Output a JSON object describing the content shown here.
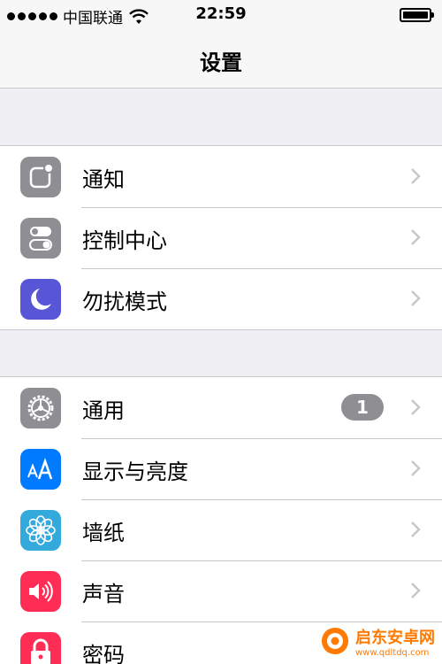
{
  "status_bar": {
    "carrier": "中国联通",
    "time": "22:59",
    "signal_icon": "signal-dots-icon",
    "wifi_icon": "wifi-icon",
    "battery_icon": "battery-icon",
    "battery_level": 1.0
  },
  "nav": {
    "title": "设置"
  },
  "groups": [
    {
      "items": [
        {
          "label": "通知",
          "icon": "notifications-icon",
          "color": "#8e8e93"
        },
        {
          "label": "控制中心",
          "icon": "control-center-icon",
          "color": "#8e8e93"
        },
        {
          "label": "勿扰模式",
          "icon": "moon-icon",
          "color": "#5856d6"
        }
      ]
    },
    {
      "items": [
        {
          "label": "通用",
          "icon": "gear-icon",
          "color": "#8e8e93",
          "badge": "1"
        },
        {
          "label": "显示与亮度",
          "icon": "display-brightness-icon",
          "color": "#007aff"
        },
        {
          "label": "墙纸",
          "icon": "wallpaper-flower-icon",
          "color": "#34aadc"
        },
        {
          "label": "声音",
          "icon": "speaker-icon",
          "color": "#ff2d55"
        },
        {
          "label": "密码",
          "icon": "lock-icon",
          "color": "#ff2d55"
        }
      ]
    }
  ],
  "watermark": {
    "name": "启东安卓网",
    "url": "www.qdltdq.com",
    "icon": "watermark-logo-icon"
  }
}
